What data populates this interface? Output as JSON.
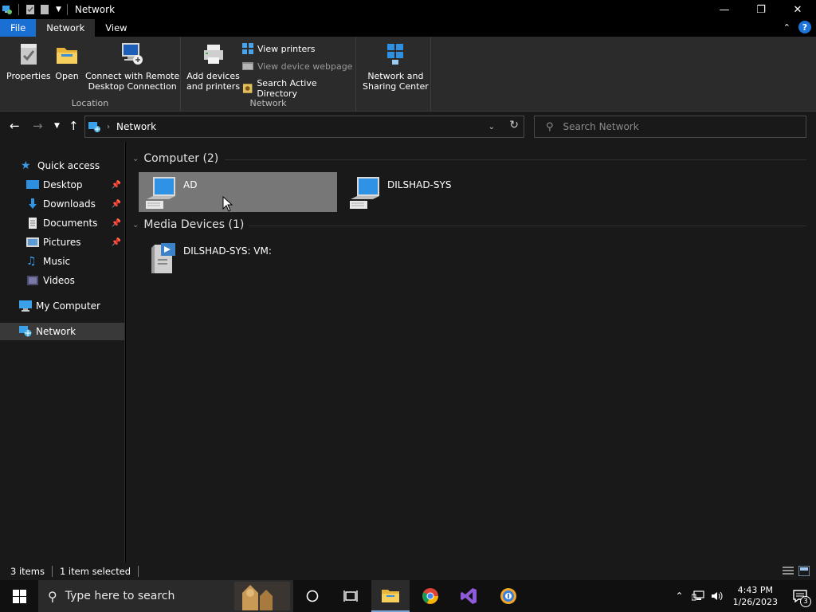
{
  "window": {
    "title": "Network",
    "minimize_glyph": "—",
    "maximize_glyph": "❐",
    "close_glyph": "✕"
  },
  "tabs": {
    "file": "File",
    "network": "Network",
    "view": "View"
  },
  "ribbon": {
    "location_group": {
      "label": "Location",
      "properties": "Properties",
      "open": "Open",
      "connect_line1": "Connect with Remote",
      "connect_line2": "Desktop Connection"
    },
    "network_group": {
      "label": "Network",
      "add_devices_line1": "Add devices",
      "add_devices_line2": "and printers",
      "view_printers": "View printers",
      "view_device_webpage": "View device webpage",
      "search_ad": "Search Active Directory"
    },
    "sharing_group": {
      "line1": "Network and",
      "line2": "Sharing Center"
    }
  },
  "address": {
    "crumb": "Network",
    "search_placeholder": "Search Network"
  },
  "sidebar": {
    "quick_access": "Quick access",
    "desktop": "Desktop",
    "downloads": "Downloads",
    "documents": "Documents",
    "pictures": "Pictures",
    "music": "Music",
    "videos": "Videos",
    "my_computer": "My Computer",
    "network": "Network"
  },
  "content": {
    "computer_group": "Computer (2)",
    "media_group": "Media Devices (1)",
    "computers": [
      "AD",
      "DILSHAD-SYS"
    ],
    "media": [
      "DILSHAD-SYS: VM:"
    ]
  },
  "status": {
    "items": "3 items",
    "selected": "1 item selected"
  },
  "taskbar": {
    "search_placeholder": "Type here to search",
    "time": "4:43 PM",
    "date": "1/26/2023",
    "notification_count": "3"
  },
  "colors": {
    "accent": "#1a6fd3",
    "selection": "#777777",
    "ribbon_bg": "#2b2b2b",
    "pane_bg": "#191919"
  }
}
